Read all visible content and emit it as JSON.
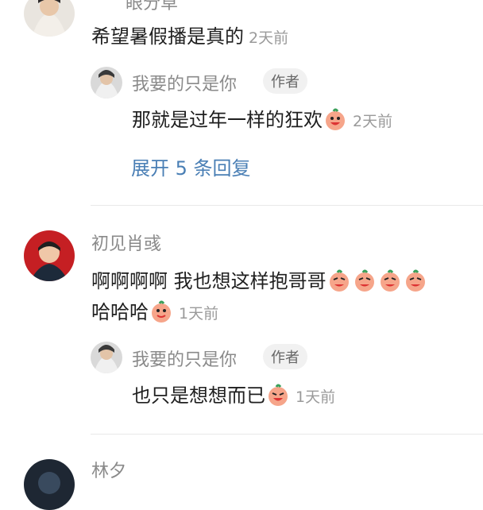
{
  "comments": [
    {
      "username": "眼分草",
      "text": "希望暑假播是真的",
      "time": "2天前",
      "reply": {
        "username": "我要的只是你",
        "badge": "作者",
        "text": "那就是过年一样的狂欢",
        "time": "2天前"
      },
      "expand_label": "展开 5 条回复"
    },
    {
      "username": "初见肖彧",
      "text_line1": "啊啊啊啊  我也想这样抱哥哥",
      "text_line2": "哈哈哈",
      "time": "1天前",
      "reply": {
        "username": "我要的只是你",
        "badge": "作者",
        "text": "也只是想想而已",
        "time": "1天前"
      }
    },
    {
      "username": "林夕"
    }
  ],
  "icons": {
    "emoji": "peach-emoji-icon"
  }
}
